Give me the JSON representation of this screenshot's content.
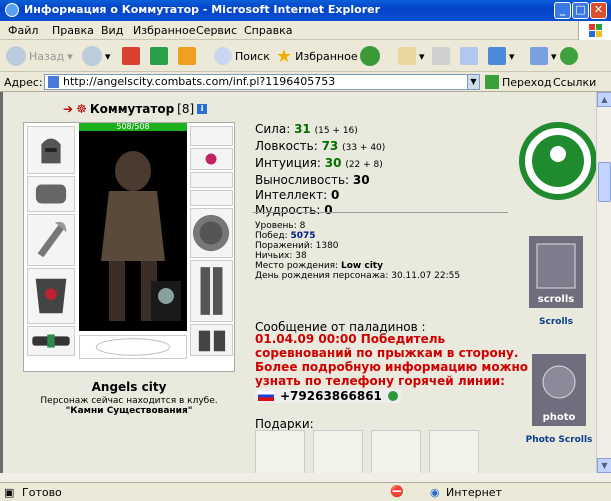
{
  "window": {
    "title": "Информация о Коммутатор - Microsoft Internet Explorer"
  },
  "menu": {
    "items": [
      "Файл",
      "Правка",
      "Вид",
      "Избранное",
      "Сервис",
      "Справка"
    ]
  },
  "toolbar": {
    "back": "Назад",
    "search": "Поиск",
    "favorites": "Избранное"
  },
  "address": {
    "label": "Адрес:",
    "url": "http://angelscity.combats.com/inf.pl?1196405753",
    "go": "Переход",
    "links": "Ссылки"
  },
  "status": {
    "left": "Готово",
    "zone": "Интернет"
  },
  "profile": {
    "nick": "Коммутатор",
    "level": "[8]",
    "hp": "508/508",
    "city": "Angels city",
    "club_line": "Персонаж сейчас находится в клубе.",
    "club_name": "\"Камни Существования\""
  },
  "stats": [
    {
      "label": "Сила:",
      "value": "31",
      "extra": "(15 + 16)"
    },
    {
      "label": "Ловкость:",
      "value": "73",
      "extra": "(33 + 40)"
    },
    {
      "label": "Интуиция:",
      "value": "30",
      "extra": "(22 + 8)"
    },
    {
      "label": "Выносливость:",
      "value": "30",
      "extra": ""
    },
    {
      "label": "Интеллект:",
      "value": "0",
      "extra": ""
    },
    {
      "label": "Мудрость:",
      "value": "0",
      "extra": ""
    }
  ],
  "bio": {
    "level": "Уровень: 8",
    "wins_label": "Побед:",
    "wins": "5075",
    "losses": "Поражений: 1380",
    "draws": "Ничьих: 38",
    "birthplace_label": "Место рождения:",
    "birthplace": "Low city",
    "birthday": "День рождения персонажа: 30.11.07 22:55"
  },
  "paladins": {
    "title": "Сообщение от паладинов :",
    "lines": [
      "01.04.09 00:00 Победитель",
      "соревнований по прыжкам в сторону.",
      "Более подробную информацию можно",
      "узнать по телефону горячей линии:"
    ],
    "phone": "+79263866861"
  },
  "gifts_label": "Подарки:",
  "side": {
    "scrolls": "Scrolls",
    "photo_scrolls": "Photo Scrolls",
    "scrolls_img": "scrolls",
    "photo_img": "photo"
  },
  "colors": {
    "accent_green": "#1f8a2e",
    "red_msg": "#d00000"
  }
}
